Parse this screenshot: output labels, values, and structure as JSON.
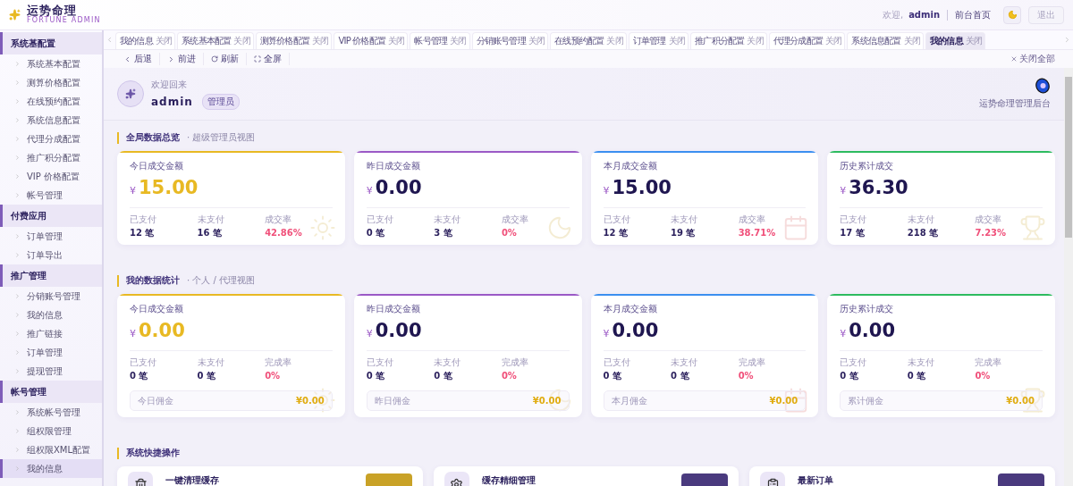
{
  "header": {
    "logo_title": "运势命理",
    "logo_subtitle": "FORTUNE ADMIN",
    "welcome": "欢迎,",
    "user": "admin",
    "home_link": "前台首页",
    "logout": "退出"
  },
  "sidebar": [
    {
      "label": "系统基配置",
      "children": [
        {
          "label": "系统基本配置",
          "selected": false
        },
        {
          "label": "测算价格配置",
          "selected": false
        },
        {
          "label": "在线预约配置",
          "selected": false
        },
        {
          "label": "系统信息配置",
          "selected": false
        },
        {
          "label": "代理分成配置",
          "selected": false
        },
        {
          "label": "推广积分配置",
          "selected": false
        },
        {
          "label": "VIP 价格配置",
          "selected": false
        },
        {
          "label": "帐号管理",
          "selected": false
        }
      ]
    },
    {
      "label": "付费应用",
      "children": [
        {
          "label": "订单管理",
          "selected": false
        },
        {
          "label": "订单导出",
          "selected": false
        }
      ]
    },
    {
      "label": "推广管理",
      "children": [
        {
          "label": "分销账号管理",
          "selected": false
        },
        {
          "label": "我的信息",
          "selected": false
        },
        {
          "label": "推广链接",
          "selected": false
        },
        {
          "label": "订单管理",
          "selected": false
        },
        {
          "label": "提现管理",
          "selected": false
        }
      ]
    },
    {
      "label": "帐号管理",
      "children": [
        {
          "label": "系统帐号管理",
          "selected": false
        },
        {
          "label": "组权限管理",
          "selected": false
        },
        {
          "label": "组权限XML配置",
          "selected": false
        },
        {
          "label": "我的信息",
          "selected": true
        }
      ]
    }
  ],
  "tabs": [
    {
      "label": "我的信息",
      "close": "关闭",
      "selected": false
    },
    {
      "label": "系统基本配置",
      "close": "关闭",
      "selected": false
    },
    {
      "label": "测算价格配置",
      "close": "关闭",
      "selected": false
    },
    {
      "label": "VIP 价格配置",
      "close": "关闭",
      "selected": false
    },
    {
      "label": "帐号管理",
      "close": "关闭",
      "selected": false
    },
    {
      "label": "分销账号管理",
      "close": "关闭",
      "selected": false
    },
    {
      "label": "在线预约配置",
      "close": "关闭",
      "selected": false
    },
    {
      "label": "订单管理",
      "close": "关闭",
      "selected": false
    },
    {
      "label": "推广积分配置",
      "close": "关闭",
      "selected": false
    },
    {
      "label": "代理分成配置",
      "close": "关闭",
      "selected": false
    },
    {
      "label": "系统信息配置",
      "close": "关闭",
      "selected": false
    },
    {
      "label": "我的信息",
      "close": "关闭",
      "selected": true
    }
  ],
  "toolbar": [
    {
      "kind": "back",
      "label": "后退"
    },
    {
      "kind": "forward",
      "label": "前进"
    },
    {
      "kind": "refresh",
      "label": "刷新"
    },
    {
      "kind": "fullscreen",
      "label": "全屏"
    }
  ],
  "close_all": "关闭全部",
  "welcome": {
    "greeting": "欢迎回来",
    "name": "admin",
    "role": "管理员",
    "brand": "运势命理管理后台"
  },
  "sections": [
    {
      "title": "全局数据总览",
      "subtitle": "· 超级管理员视图",
      "cards": [
        {
          "kind": "today",
          "title": "今日成交金额",
          "currency": "¥",
          "amount": "15.00",
          "color": "#e8b923",
          "stats": [
            {
              "label": "已支付",
              "value": "12 笔"
            },
            {
              "label": "未支付",
              "value": "16 笔"
            },
            {
              "label": "成交率",
              "value": "42.86%"
            }
          ]
        },
        {
          "kind": "yesterday",
          "title": "昨日成交金额",
          "currency": "¥",
          "amount": "0.00",
          "color": "#9b59c6",
          "stats": [
            {
              "label": "已支付",
              "value": "0 笔"
            },
            {
              "label": "未支付",
              "value": "3 笔"
            },
            {
              "label": "成交率",
              "value": "0%"
            }
          ]
        },
        {
          "kind": "month",
          "title": "本月成交金额",
          "currency": "¥",
          "amount": "15.00",
          "color": "#3b8ff0",
          "stats": [
            {
              "label": "已支付",
              "value": "12 笔"
            },
            {
              "label": "未支付",
              "value": "19 笔"
            },
            {
              "label": "成交率",
              "value": "38.71%"
            }
          ]
        },
        {
          "kind": "total",
          "title": "历史累计成交",
          "currency": "¥",
          "amount": "36.30",
          "color": "#2dbb5f",
          "stats": [
            {
              "label": "已支付",
              "value": "17 笔"
            },
            {
              "label": "未支付",
              "value": "218 笔"
            },
            {
              "label": "成交率",
              "value": "7.23%"
            }
          ]
        }
      ]
    },
    {
      "title": "我的数据统计",
      "subtitle": "· 个人 / 代理视图",
      "cards": [
        {
          "kind": "today",
          "title": "今日成交金额",
          "currency": "¥",
          "amount": "0.00",
          "color": "#e8b923",
          "stats": [
            {
              "label": "已支付",
              "value": "0 笔"
            },
            {
              "label": "未支付",
              "value": "0 笔"
            },
            {
              "label": "完成率",
              "value": "0%"
            }
          ],
          "commission": {
            "label": "今日佣金",
            "value": "¥0.00"
          }
        },
        {
          "kind": "yesterday",
          "title": "昨日成交金额",
          "currency": "¥",
          "amount": "0.00",
          "color": "#9b59c6",
          "stats": [
            {
              "label": "已支付",
              "value": "0 笔"
            },
            {
              "label": "未支付",
              "value": "0 笔"
            },
            {
              "label": "完成率",
              "value": "0%"
            }
          ],
          "commission": {
            "label": "昨日佣金",
            "value": "¥0.00"
          }
        },
        {
          "kind": "month",
          "title": "本月成交金额",
          "currency": "¥",
          "amount": "0.00",
          "color": "#3b8ff0",
          "stats": [
            {
              "label": "已支付",
              "value": "0 笔"
            },
            {
              "label": "未支付",
              "value": "0 笔"
            },
            {
              "label": "完成率",
              "value": "0%"
            }
          ],
          "commission": {
            "label": "本月佣金",
            "value": "¥0.00"
          }
        },
        {
          "kind": "total",
          "title": "历史累计成交",
          "currency": "¥",
          "amount": "0.00",
          "color": "#2dbb5f",
          "stats": [
            {
              "label": "已支付",
              "value": "0 笔"
            },
            {
              "label": "未支付",
              "value": "0 笔"
            },
            {
              "label": "完成率",
              "value": "0%"
            }
          ],
          "commission": {
            "label": "累计佣金",
            "value": "¥0.00"
          }
        }
      ]
    }
  ],
  "quick_actions": {
    "title": "系统快捷操作",
    "items": [
      {
        "kind": "clear",
        "title": "一键清理缓存",
        "color": "#c9a227"
      },
      {
        "kind": "cache",
        "title": "缓存精细管理",
        "color": "#4a3a7e"
      },
      {
        "kind": "orders",
        "title": "最新订单",
        "color": "#4a3a7e"
      }
    ]
  }
}
